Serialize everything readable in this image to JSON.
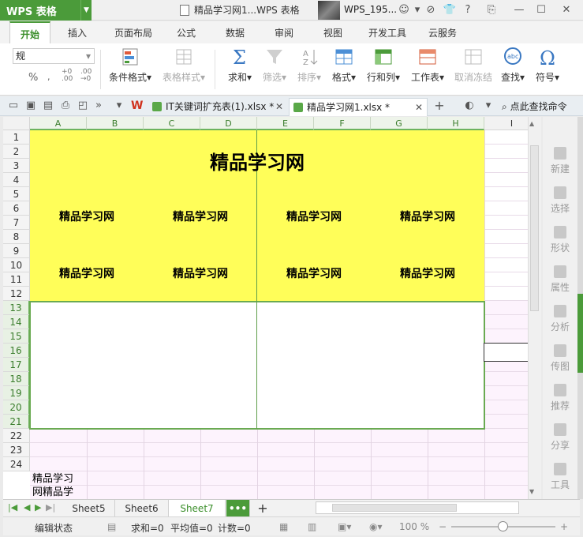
{
  "app": {
    "name": "WPS 表格",
    "window_title": "精品学习网1...WPS 表格",
    "user": "WPS_195..."
  },
  "ribbon_tabs": [
    "开始",
    "插入",
    "页面布局",
    "公式",
    "数据",
    "审阅",
    "视图",
    "开发工具",
    "云服务"
  ],
  "ribbon": {
    "number_format": "规",
    "percent": "%",
    "conditional_format": "条件格式",
    "table_style": "表格样式",
    "sum": "求和",
    "filter": "筛选",
    "sort": "排序",
    "format": "格式",
    "row_col": "行和列",
    "worksheet": "工作表",
    "unmerge": "取消冻结",
    "find": "查找",
    "symbol": "符号"
  },
  "doc_tabs": [
    {
      "label": "IT关键词扩充表(1).xlsx *"
    },
    {
      "label": "精品学习网1.xlsx *"
    }
  ],
  "search_placeholder": "点此查找命令",
  "columns": [
    "A",
    "B",
    "C",
    "D",
    "E",
    "F",
    "G",
    "H",
    "I"
  ],
  "rows": [
    "1",
    "2",
    "3",
    "4",
    "5",
    "6",
    "7",
    "8",
    "9",
    "10",
    "11",
    "12",
    "13",
    "14",
    "15",
    "16",
    "17",
    "18",
    "19",
    "20",
    "21",
    "22",
    "23",
    "24"
  ],
  "sheet": {
    "title": "精品学习网",
    "labels_row1": [
      "精品学习网",
      "精品学习网",
      "精品学习网",
      "精品学习网"
    ],
    "labels_row2": [
      "精品学习网",
      "精品学习网",
      "精品学习网",
      "精品学习网"
    ],
    "a25_line1": "精品学习",
    "a25_line2": "网精品学"
  },
  "task_pane": [
    "新建",
    "选择",
    "形状",
    "属性",
    "分析",
    "传图",
    "推荐",
    "分享",
    "工具"
  ],
  "sheet_tabs": [
    "Sheet5",
    "Sheet6",
    "Sheet7"
  ],
  "active_sheet": "Sheet7",
  "more_sheets": "•••",
  "add_sheet": "+",
  "status": {
    "mode": "编辑状态",
    "sum": "求和=0",
    "avg": "平均值=0",
    "count": "计数=0",
    "zoom": "100 %"
  },
  "colors": {
    "accent": "#4b9b3a",
    "highlight": "#fffe59",
    "pink_grid": "#fdf3fd"
  },
  "icons": {
    "sum": "sigma-icon",
    "filter": "funnel-icon",
    "find": "binoculars-icon",
    "symbol": "omega-icon"
  }
}
